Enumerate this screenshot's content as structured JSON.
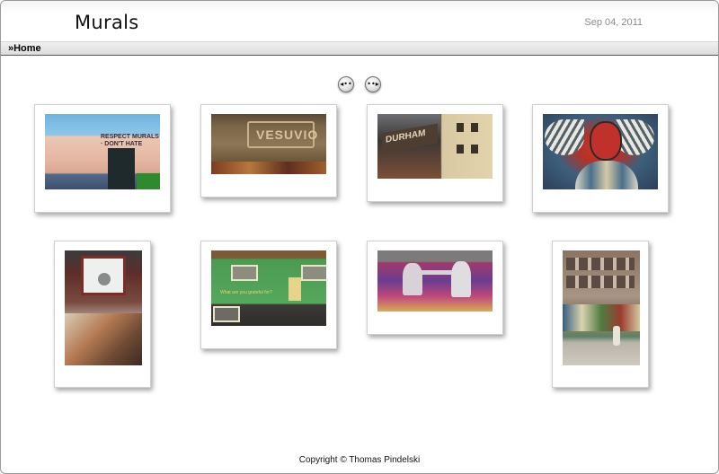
{
  "header": {
    "title": "Murals",
    "date": "Sep 04, 2011"
  },
  "nav": {
    "home_label": "»Home"
  },
  "pager": {
    "prev_icon": "arrow-left-circle-icon",
    "prev_glyph": "◂••",
    "next_icon": "arrow-right-circle-icon",
    "next_glyph": "••▸"
  },
  "gallery": {
    "items": [
      {
        "name": "respect-mural-photo",
        "mural_text": "RESPECT MURALS · DON'T HATE"
      },
      {
        "name": "vesuvio-mural-photo",
        "mural_text": "VESUVIO"
      },
      {
        "name": "durham-building-photo",
        "mural_text": "DURHAM"
      },
      {
        "name": "red-face-mural-photo"
      },
      {
        "name": "window-mural-photo"
      },
      {
        "name": "green-building-photo",
        "mural_text": "What are you grateful for?"
      },
      {
        "name": "two-faces-mural-photo"
      },
      {
        "name": "street-graffiti-photo"
      }
    ]
  },
  "footer": {
    "copyright": "Copyright © Thomas Pindelski"
  }
}
